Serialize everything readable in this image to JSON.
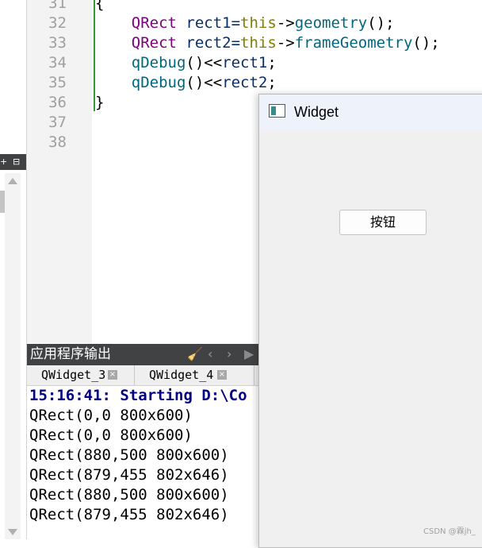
{
  "editor": {
    "lines": [
      {
        "num": "31",
        "tokens": [
          {
            "t": "{",
            "c": "def"
          }
        ]
      },
      {
        "num": "32",
        "tokens": [
          {
            "t": "    ",
            "c": "def"
          },
          {
            "t": "QRect",
            "c": "type"
          },
          {
            "t": " rect1=",
            "c": "var"
          },
          {
            "t": "this",
            "c": "kw"
          },
          {
            "t": "->",
            "c": "def"
          },
          {
            "t": "geometry",
            "c": "fn"
          },
          {
            "t": "();",
            "c": "def"
          }
        ]
      },
      {
        "num": "33",
        "tokens": [
          {
            "t": "    ",
            "c": "def"
          },
          {
            "t": "QRect",
            "c": "type"
          },
          {
            "t": " rect2=",
            "c": "var"
          },
          {
            "t": "this",
            "c": "kw"
          },
          {
            "t": "->",
            "c": "def"
          },
          {
            "t": "frameGeometry",
            "c": "fn"
          },
          {
            "t": "();",
            "c": "def"
          }
        ]
      },
      {
        "num": "34",
        "tokens": [
          {
            "t": "    ",
            "c": "def"
          },
          {
            "t": "qDebug",
            "c": "fn"
          },
          {
            "t": "()<<",
            "c": "def"
          },
          {
            "t": "rect1",
            "c": "var"
          },
          {
            "t": ";",
            "c": "def"
          }
        ]
      },
      {
        "num": "35",
        "tokens": [
          {
            "t": "    ",
            "c": "def"
          },
          {
            "t": "qDebug",
            "c": "fn"
          },
          {
            "t": "()<<",
            "c": "def"
          },
          {
            "t": "rect2",
            "c": "var"
          },
          {
            "t": ";",
            "c": "def"
          }
        ]
      },
      {
        "num": "36",
        "tokens": [
          {
            "t": "}",
            "c": "def"
          }
        ]
      },
      {
        "num": "37",
        "tokens": []
      },
      {
        "num": "38",
        "tokens": []
      }
    ]
  },
  "output_pane": {
    "title": "应用程序输出",
    "tabs": [
      {
        "label": "QWidget_3",
        "close": "×"
      },
      {
        "label": "QWidget_4",
        "close": "×"
      }
    ],
    "lines": [
      "15:16:41: Starting D:\\Co",
      "QRect(0,0 800x600)",
      "QRect(0,0 800x600)",
      "QRect(880,500 800x600)",
      "QRect(879,455 802x646)",
      "QRect(880,500 800x600)",
      "QRect(879,455 802x646)"
    ]
  },
  "widget_window": {
    "title": "Widget",
    "button_label": "按钮"
  },
  "left_panel": {
    "plus": "+",
    "split": "⊟"
  },
  "watermark": "CSDN @霖jh_",
  "icons": {
    "clear": "broom-icon",
    "prev": "chevron-left-icon",
    "next": "chevron-right-icon",
    "run": "play-icon"
  },
  "colors": {
    "type": "#800080",
    "keyword": "#808000",
    "function": "#00677c",
    "variable": "#092e64",
    "status": "#000080",
    "header_bg": "#404244"
  }
}
